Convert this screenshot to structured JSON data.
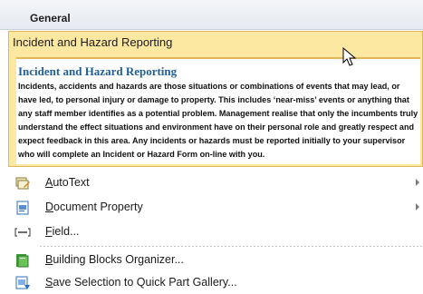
{
  "menu": {
    "section_title": "General",
    "gallery_item": {
      "title": "Incident and Hazard Reporting",
      "preview_title": "Incident and Hazard Reporting",
      "preview_body": "Incidents, accidents and hazards are those situations or combinations of events that may lead, or have led, to personal injury or damage to property. This includes ‘near-miss’ events or anything that any staff member identifies as a potential problem. Management realise that only the incumbents truly understand the effect situations and environment have on their personal role and greatly respect and expect feedback in this area. Any incidents or hazards must be reported initially to your supervisor who will complete an Incident or Hazard Form on-line with you."
    },
    "items": [
      {
        "key": "A",
        "rest": "utoText",
        "icon": "autotext-icon",
        "submenu": true
      },
      {
        "key": "D",
        "rest": "ocument Property",
        "icon": "document-property-icon",
        "submenu": true
      },
      {
        "key": "F",
        "rest": "ield...",
        "icon": "field-icon",
        "submenu": false
      },
      {
        "key": "B",
        "rest": "uilding Blocks Organizer...",
        "icon": "building-blocks-icon",
        "submenu": false
      },
      {
        "key": "S",
        "rest": "ave Selection to Quick Part Gallery...",
        "icon": "save-selection-icon",
        "submenu": false
      }
    ]
  }
}
